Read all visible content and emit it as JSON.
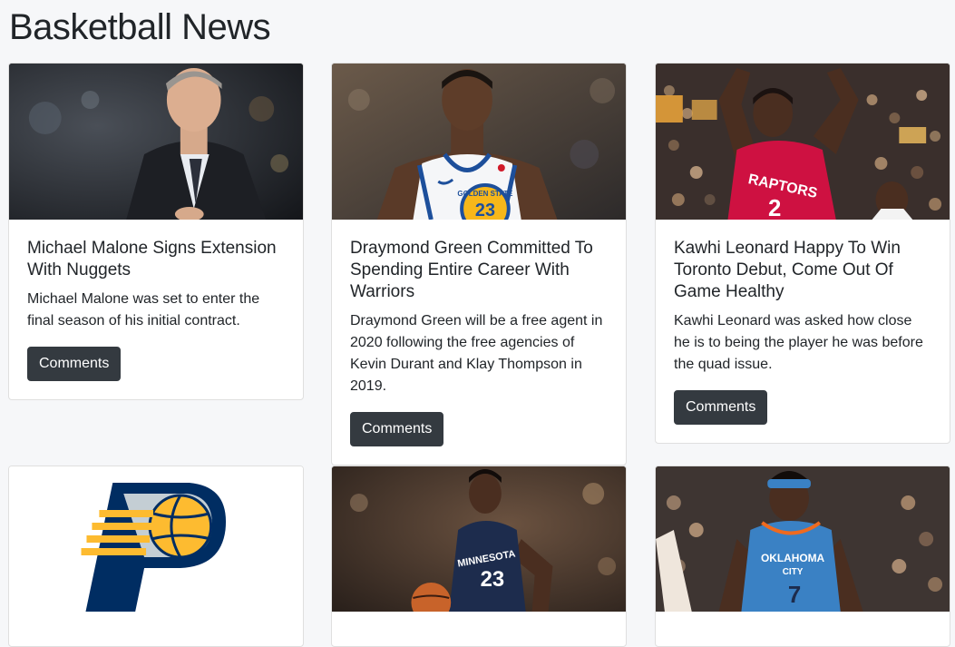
{
  "page": {
    "title": "Basketball News"
  },
  "articles": [
    {
      "title": "Michael Malone Signs Extension With Nuggets",
      "text": "Michael Malone was set to enter the final season of his initial contract.",
      "button": "Comments",
      "image": "coach-photo"
    },
    {
      "title": "Draymond Green Committed To Spending Entire Career With Warriors",
      "text": "Draymond Green will be a free agent in 2020 following the free agencies of Kevin Durant and Klay Thompson in 2019.",
      "button": "Comments",
      "image": "warriors-player-photo",
      "jersey": "GOLDEN STATE"
    },
    {
      "title": "Kawhi Leonard Happy To Win Toronto Debut, Come Out Of Game Healthy",
      "text": "Kawhi Leonard was asked how close he is to being the player he was before the quad issue.",
      "button": "Comments",
      "image": "raptors-player-photo",
      "jersey": "RAPTORS",
      "number": "2"
    },
    {
      "title": "",
      "text": "",
      "button": "",
      "image": "pacers-logo"
    },
    {
      "title": "",
      "text": "",
      "button": "",
      "image": "timberwolves-player-photo",
      "jersey": "MINNESOTA",
      "number": "23"
    },
    {
      "title": "",
      "text": "",
      "button": "",
      "image": "thunder-player-photo",
      "jersey": "OKLAHOMA CITY",
      "number": "7"
    }
  ],
  "colors": {
    "button_bg": "#343a40",
    "page_bg": "#f6f7f9",
    "card_border": "rgba(0,0,0,0.125)"
  }
}
